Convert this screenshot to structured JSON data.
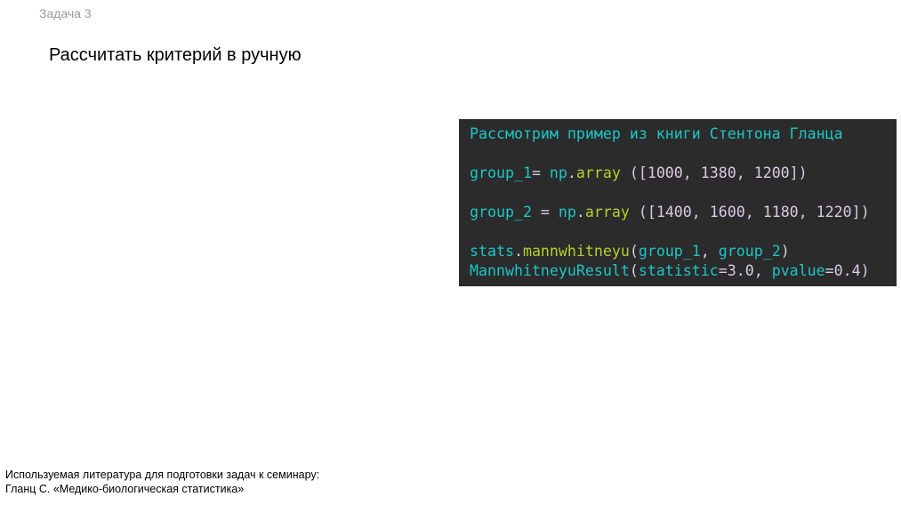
{
  "header": {
    "task_label": "Задача 3",
    "title": "Рассчитать критерий в ручную"
  },
  "code_block": {
    "colors": {
      "background": "#2b2b2b",
      "identifier": "#1cc6c6",
      "function": "#b5d02e",
      "literal": "#d8cce4"
    },
    "lines": [
      [
        {
          "t": "Рассмотрим пример из книги Стентона Гланца",
          "k": "c"
        }
      ],
      [],
      [
        {
          "t": "group_1",
          "k": "c"
        },
        {
          "t": "= ",
          "k": "n"
        },
        {
          "t": "np",
          "k": "c"
        },
        {
          "t": ".",
          "k": "n"
        },
        {
          "t": "array",
          "k": "f"
        },
        {
          "t": " ([1000, 1380, 1200])",
          "k": "n"
        }
      ],
      [],
      [
        {
          "t": "group_2",
          "k": "c"
        },
        {
          "t": " = ",
          "k": "n"
        },
        {
          "t": "np",
          "k": "c"
        },
        {
          "t": ".",
          "k": "n"
        },
        {
          "t": "array",
          "k": "f"
        },
        {
          "t": " ([1400, 1600, 1180, 1220])",
          "k": "n"
        }
      ],
      [],
      [
        {
          "t": "stats",
          "k": "c"
        },
        {
          "t": ".",
          "k": "n"
        },
        {
          "t": "mannwhitneyu",
          "k": "f"
        },
        {
          "t": "(",
          "k": "n"
        },
        {
          "t": "group_1",
          "k": "c"
        },
        {
          "t": ", ",
          "k": "n"
        },
        {
          "t": "group_2",
          "k": "c"
        },
        {
          "t": ")",
          "k": "n"
        }
      ],
      [
        {
          "t": "MannwhitneyuResult",
          "k": "c"
        },
        {
          "t": "(",
          "k": "n"
        },
        {
          "t": "statistic",
          "k": "c"
        },
        {
          "t": "=3.0, ",
          "k": "n"
        },
        {
          "t": "pvalue",
          "k": "c"
        },
        {
          "t": "=0.4)",
          "k": "n"
        }
      ]
    ]
  },
  "footer": {
    "line1": "Используемая литература для подготовки задач к семинару:",
    "line2": "Гланц С. «Медико-биологическая статистика»"
  }
}
